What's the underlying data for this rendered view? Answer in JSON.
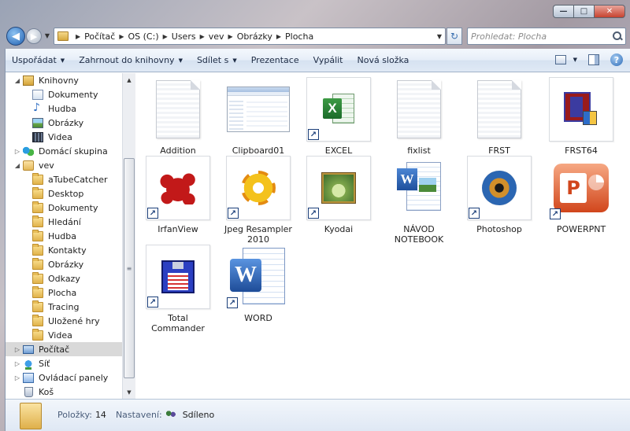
{
  "window": {
    "minimize_glyph": "—",
    "maximize_glyph": "□",
    "close_glyph": "✕"
  },
  "address": {
    "breadcrumbs": [
      "Počítač",
      "OS (C:)",
      "Users",
      "vev",
      "Obrázky",
      "Plocha"
    ],
    "search_placeholder": "Prohledat: Plocha"
  },
  "toolbar": {
    "organize_label": "Uspořádat",
    "include_label": "Zahrnout do knihovny",
    "share_label": "Sdílet s",
    "slideshow_label": "Prezentace",
    "burn_label": "Vypálit",
    "new_folder_label": "Nová složka",
    "help_glyph": "?"
  },
  "sidebar": {
    "items": [
      {
        "label": "Knihovny",
        "icon": "library-icon"
      },
      {
        "label": "Dokumenty",
        "icon": "documents-icon"
      },
      {
        "label": "Hudba",
        "icon": "music-icon"
      },
      {
        "label": "Obrázky",
        "icon": "pictures-icon"
      },
      {
        "label": "Videa",
        "icon": "videos-icon"
      },
      {
        "label": "Domácí skupina",
        "icon": "homegroup-icon"
      },
      {
        "label": "vev",
        "icon": "user-folder-icon"
      },
      {
        "label": "aTubeCatcher",
        "icon": "folder-icon"
      },
      {
        "label": "Desktop",
        "icon": "folder-icon"
      },
      {
        "label": "Dokumenty",
        "icon": "folder-icon"
      },
      {
        "label": "Hledání",
        "icon": "folder-icon"
      },
      {
        "label": "Hudba",
        "icon": "folder-icon"
      },
      {
        "label": "Kontakty",
        "icon": "folder-icon"
      },
      {
        "label": "Obrázky",
        "icon": "folder-icon"
      },
      {
        "label": "Odkazy",
        "icon": "folder-icon"
      },
      {
        "label": "Plocha",
        "icon": "folder-icon"
      },
      {
        "label": "Tracing",
        "icon": "folder-icon"
      },
      {
        "label": "Uložené hry",
        "icon": "folder-icon"
      },
      {
        "label": "Videa",
        "icon": "folder-icon"
      },
      {
        "label": "Počítač",
        "icon": "computer-icon",
        "selected": true
      },
      {
        "label": "Síť",
        "icon": "network-icon"
      },
      {
        "label": "Ovládací panely",
        "icon": "control-panel-icon"
      },
      {
        "label": "Koš",
        "icon": "recycle-bin-icon"
      }
    ]
  },
  "files": [
    {
      "label": "Addition",
      "icon": "text-file-icon",
      "shortcut": false
    },
    {
      "label": "Clipboard01",
      "icon": "image-thumbnail-icon",
      "shortcut": false
    },
    {
      "label": "EXCEL",
      "icon": "excel-icon",
      "shortcut": true
    },
    {
      "label": "fixlist",
      "icon": "text-file-icon",
      "shortcut": false
    },
    {
      "label": "FRST",
      "icon": "text-file-icon",
      "shortcut": false
    },
    {
      "label": "FRST64",
      "icon": "frst64-icon",
      "shortcut": false
    },
    {
      "label": "IrfanView",
      "icon": "irfanview-icon",
      "shortcut": true
    },
    {
      "label": "Jpeg Resampler\n2010",
      "icon": "jpeg-resampler-icon",
      "shortcut": true
    },
    {
      "label": "Kyodai",
      "icon": "kyodai-icon",
      "shortcut": true
    },
    {
      "label": "NÁVOD\nNOTEBOOK",
      "icon": "word-document-icon",
      "shortcut": false
    },
    {
      "label": "Photoshop",
      "icon": "photoshop-icon",
      "shortcut": true
    },
    {
      "label": "POWERPNT",
      "icon": "powerpoint-icon",
      "shortcut": true
    },
    {
      "label": "Total\nCommander",
      "icon": "total-commander-icon",
      "shortcut": true
    },
    {
      "label": "WORD",
      "icon": "word-icon",
      "shortcut": true
    }
  ],
  "details": {
    "items_label": "Položky:",
    "items_count": "14",
    "settings_label": "Nastavení:",
    "shared_value": "Sdíleno"
  }
}
